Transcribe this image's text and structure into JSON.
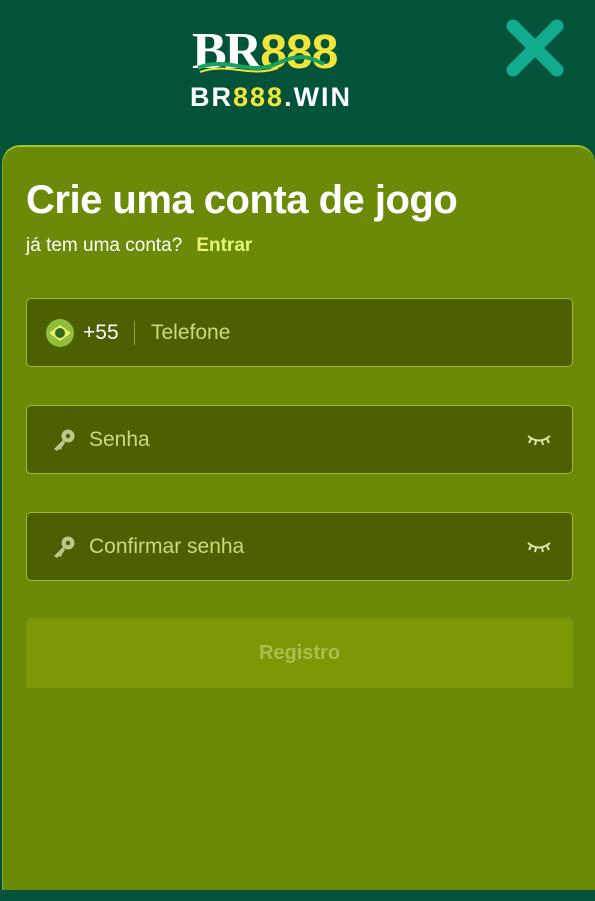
{
  "header": {
    "logo_br": "BR",
    "logo_888": "888",
    "logo_sub_prefix": "BR",
    "logo_sub_888": "888",
    "logo_sub_suffix": ".WIN",
    "close_icon": "close-x-icon"
  },
  "form": {
    "title": "Crie uma conta de jogo",
    "have_account": "já tem uma conta?",
    "login_link": "Entrar",
    "phone": {
      "flag_icon": "brazil-flag-icon",
      "country_code": "+55",
      "placeholder": "Telefone",
      "value": ""
    },
    "password": {
      "icon": "key-icon",
      "placeholder": "Senha",
      "value": "",
      "toggle_icon": "eye-closed-icon"
    },
    "confirm_password": {
      "icon": "key-icon",
      "placeholder": "Confirmar senha",
      "value": "",
      "toggle_icon": "eye-closed-icon"
    },
    "submit_label": "Registro"
  },
  "colors": {
    "header_bg": "#03533a",
    "card_bg": "#6b8a07",
    "input_bg": "#4b5f03",
    "accent_yellow": "#f2e43a",
    "link_color": "#e7f67a",
    "button_bg": "#7d9807",
    "close_icon": "#13b59a"
  }
}
